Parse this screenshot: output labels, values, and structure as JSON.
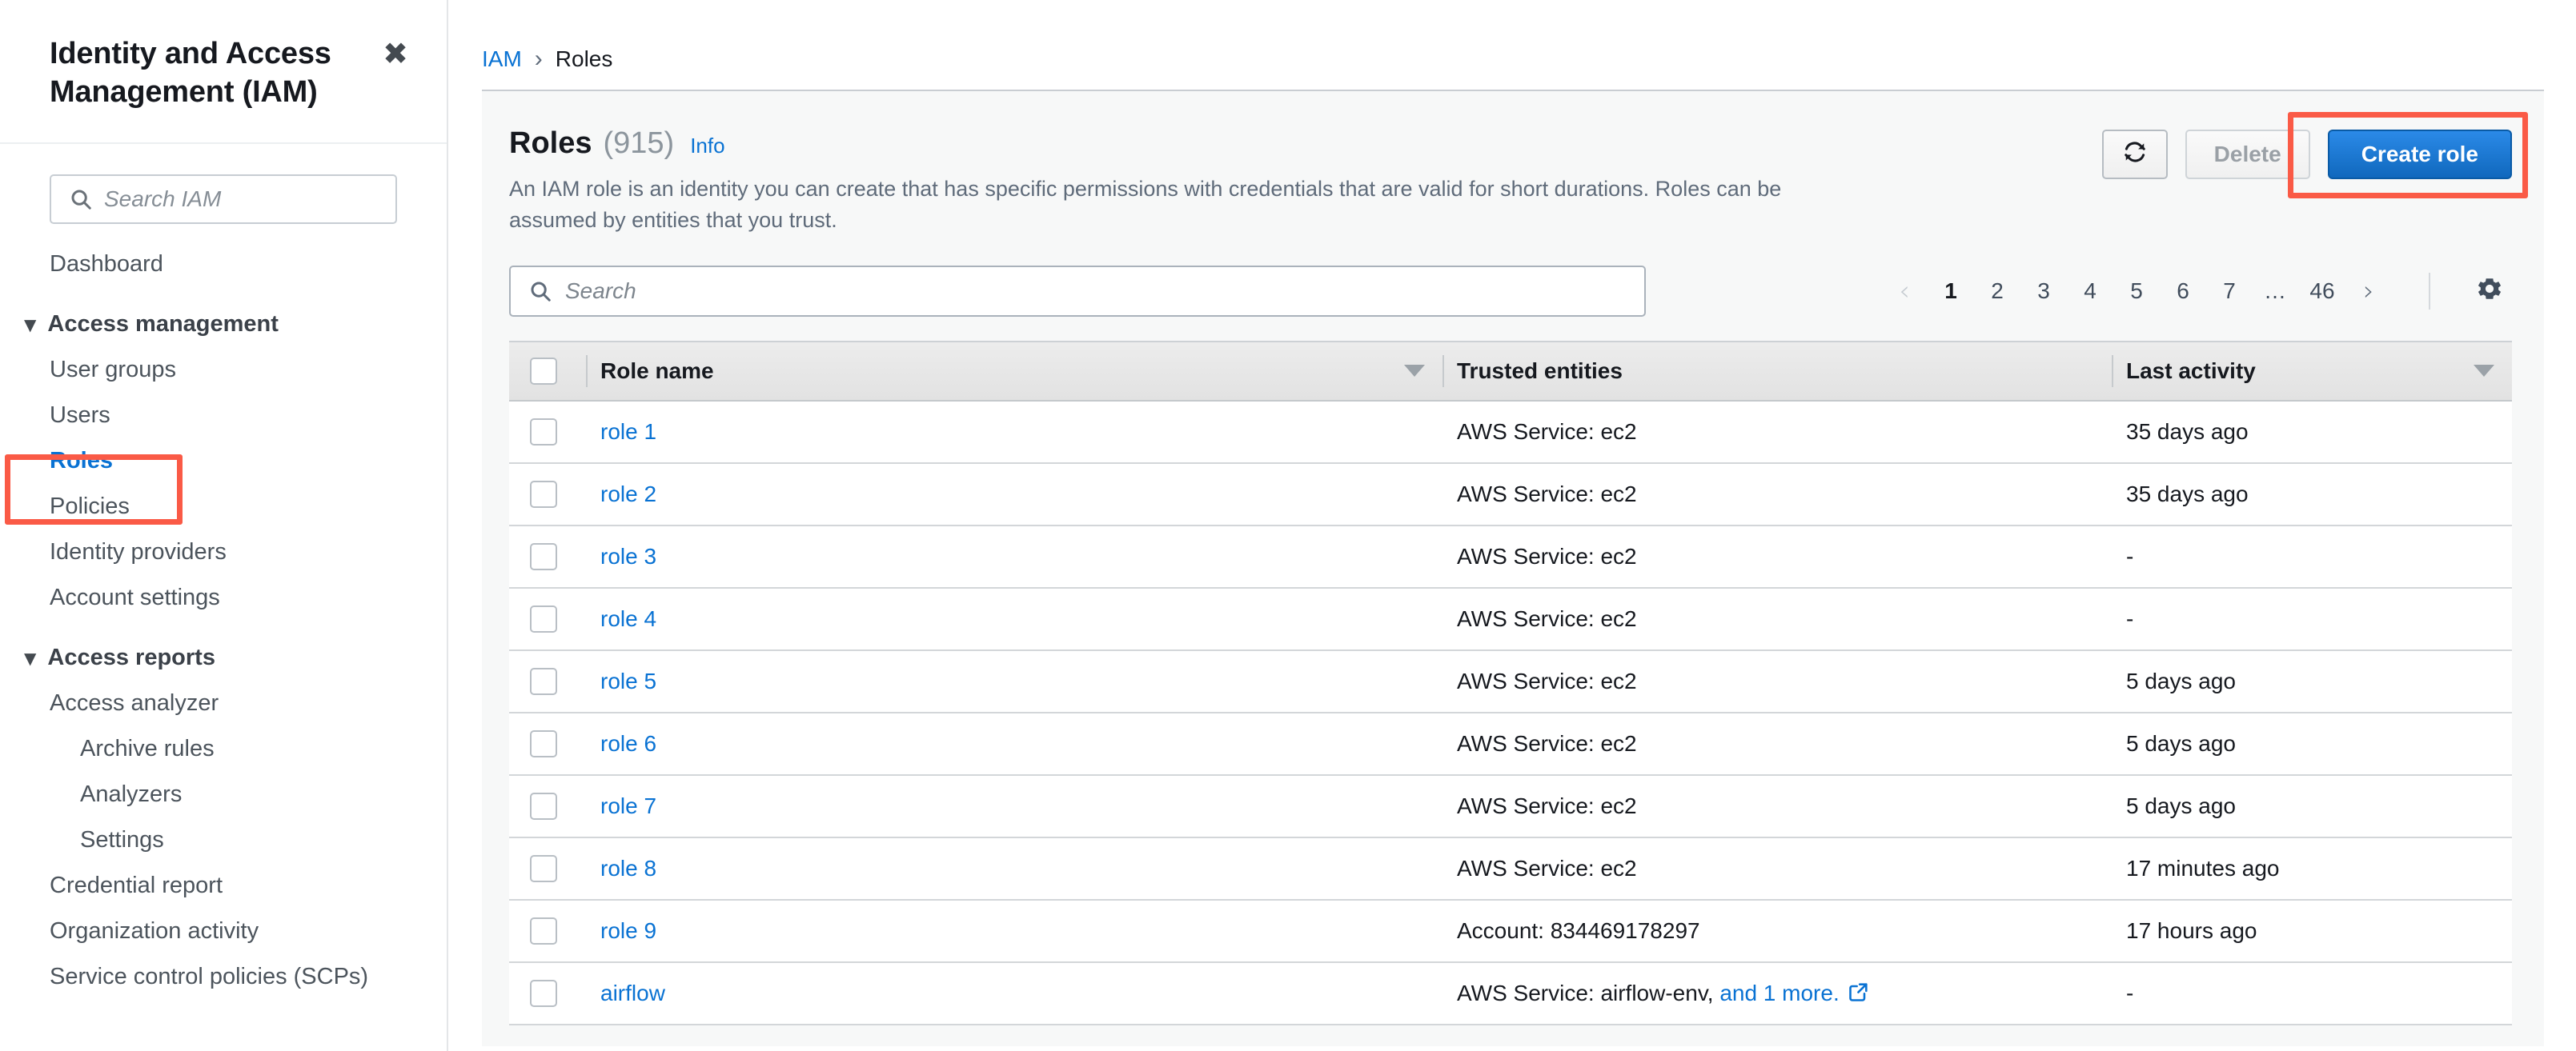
{
  "sidebar": {
    "title": "Identity and Access Management (IAM)",
    "close_label": "✖",
    "search": {
      "placeholder": "Search IAM",
      "value": ""
    },
    "items": [
      {
        "label": "Dashboard",
        "level": "top",
        "active": false
      },
      {
        "label": "Access management",
        "level": "group",
        "active": false
      },
      {
        "label": "User groups",
        "level": "sub",
        "active": false
      },
      {
        "label": "Users",
        "level": "sub",
        "active": false
      },
      {
        "label": "Roles",
        "level": "sub",
        "active": true
      },
      {
        "label": "Policies",
        "level": "sub",
        "active": false
      },
      {
        "label": "Identity providers",
        "level": "sub",
        "active": false
      },
      {
        "label": "Account settings",
        "level": "sub",
        "active": false
      },
      {
        "label": "Access reports",
        "level": "group",
        "active": false
      },
      {
        "label": "Access analyzer",
        "level": "sub",
        "active": false
      },
      {
        "label": "Archive rules",
        "level": "sub2",
        "active": false
      },
      {
        "label": "Analyzers",
        "level": "sub2",
        "active": false
      },
      {
        "label": "Settings",
        "level": "sub2",
        "active": false
      },
      {
        "label": "Credential report",
        "level": "sub",
        "active": false
      },
      {
        "label": "Organization activity",
        "level": "sub",
        "active": false
      },
      {
        "label": "Service control policies (SCPs)",
        "level": "sub",
        "active": false
      }
    ]
  },
  "breadcrumb": {
    "root": "IAM",
    "separator": "›",
    "current": "Roles"
  },
  "panel": {
    "title": "Roles",
    "count": "(915)",
    "info_label": "Info",
    "description": "An IAM role is an identity you can create that has specific permissions with credentials that are valid for short durations. Roles can be assumed by entities that you trust."
  },
  "toolbar": {
    "refresh_label": "↻",
    "delete_label": "Delete",
    "create_label": "Create role"
  },
  "search": {
    "placeholder": "Search",
    "value": ""
  },
  "pagination": {
    "prev": "‹",
    "next": "›",
    "pages": [
      "1",
      "2",
      "3",
      "4",
      "5",
      "6",
      "7",
      "…",
      "46"
    ],
    "current": "1",
    "settings_label": "Preferences"
  },
  "table": {
    "columns": [
      "Role name",
      "Trusted entities",
      "Last activity"
    ],
    "rows": [
      {
        "name": "role 1",
        "trusted": "AWS Service: ec2",
        "trusted_link": "",
        "activity": "35 days ago"
      },
      {
        "name": "role 2",
        "trusted": "AWS Service: ec2",
        "trusted_link": "",
        "activity": "35 days ago"
      },
      {
        "name": "role 3",
        "trusted": "AWS Service: ec2",
        "trusted_link": "",
        "activity": "-"
      },
      {
        "name": "role 4",
        "trusted": "AWS Service: ec2",
        "trusted_link": "",
        "activity": "-"
      },
      {
        "name": "role 5",
        "trusted": "AWS Service: ec2",
        "trusted_link": "",
        "activity": "5 days ago"
      },
      {
        "name": "role 6",
        "trusted": "AWS Service: ec2",
        "trusted_link": "",
        "activity": "5 days ago"
      },
      {
        "name": "role 7",
        "trusted": "AWS Service: ec2",
        "trusted_link": "",
        "activity": "5 days ago"
      },
      {
        "name": "role 8",
        "trusted": "AWS Service: ec2",
        "trusted_link": "",
        "activity": "17 minutes ago"
      },
      {
        "name": "role 9",
        "trusted": "Account: 834469178297",
        "trusted_link": "",
        "activity": "17 hours ago"
      },
      {
        "name": "airflow",
        "trusted": "AWS Service: airflow-env,",
        "trusted_link": "and 1 more.",
        "activity": "-"
      }
    ]
  },
  "colors": {
    "link": "#0972d3",
    "primary_button": "#1068bd",
    "annotation": "#fa5a46",
    "text": "#16191f",
    "muted": "#5f6b7a"
  }
}
